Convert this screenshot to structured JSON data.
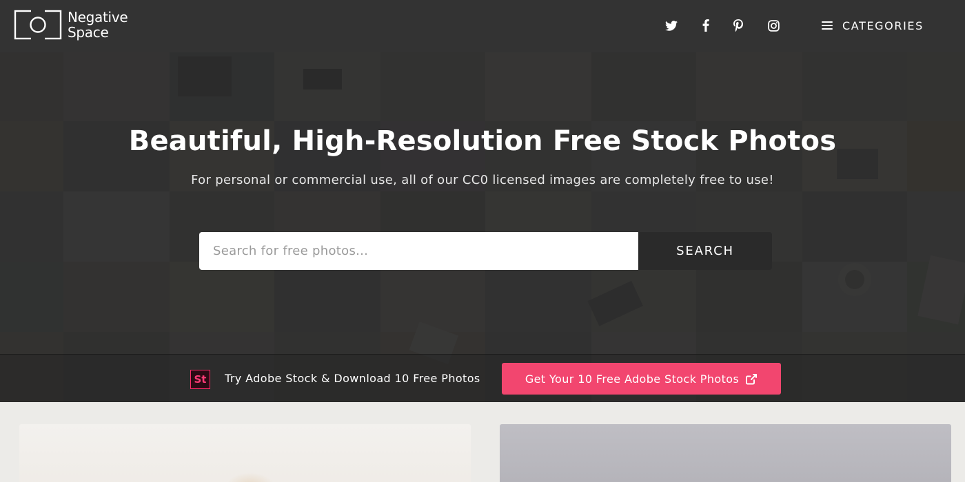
{
  "header": {
    "logo": {
      "line1": "Negative",
      "line2": "Space"
    },
    "social": [
      {
        "name": "twitter-icon"
      },
      {
        "name": "facebook-icon"
      },
      {
        "name": "pinterest-icon"
      },
      {
        "name": "instagram-icon"
      }
    ],
    "categories_label": "CATEGORIES"
  },
  "hero": {
    "title": "Beautiful, High-Resolution Free Stock Photos",
    "subtitle": "For personal or commercial use, all of our CC0 licensed images are completely free to use!",
    "search": {
      "placeholder": "Search for free photos...",
      "value": "",
      "button_label": "SEARCH"
    }
  },
  "promo": {
    "icon_text": "St",
    "text": "Try Adobe Stock & Download 10 Free Photos",
    "button_label": "Get Your 10 Free Adobe Stock Photos",
    "button_color": "#f2466f"
  },
  "colors": {
    "header_bg": "#333333",
    "hero_overlay": "#2b2b2b",
    "search_button_bg": "#2a2a2a",
    "accent_pink": "#f2466f",
    "page_bg": "#ecebe8"
  }
}
